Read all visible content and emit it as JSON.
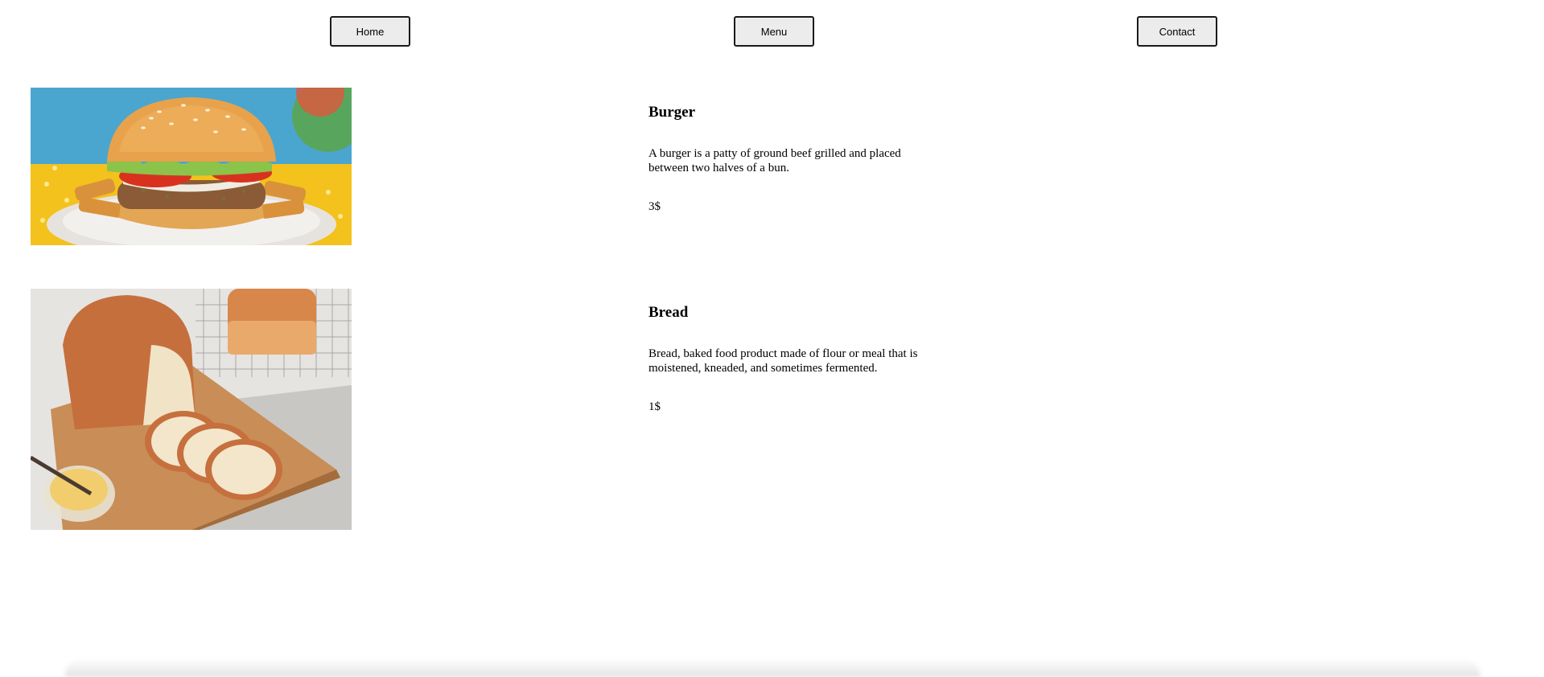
{
  "nav": {
    "home_label": "Home",
    "menu_label": "Menu",
    "contact_label": "Contact"
  },
  "items": [
    {
      "name": "Burger",
      "description": "A burger is a patty of ground beef grilled and placed between two halves of a bun.",
      "price": "3$",
      "image": "burger-photo"
    },
    {
      "name": "Bread",
      "description": "Bread, baked food product made of flour or meal that is moistened, kneaded, and sometimes fermented.",
      "price": "1$",
      "image": "bread-photo"
    }
  ]
}
